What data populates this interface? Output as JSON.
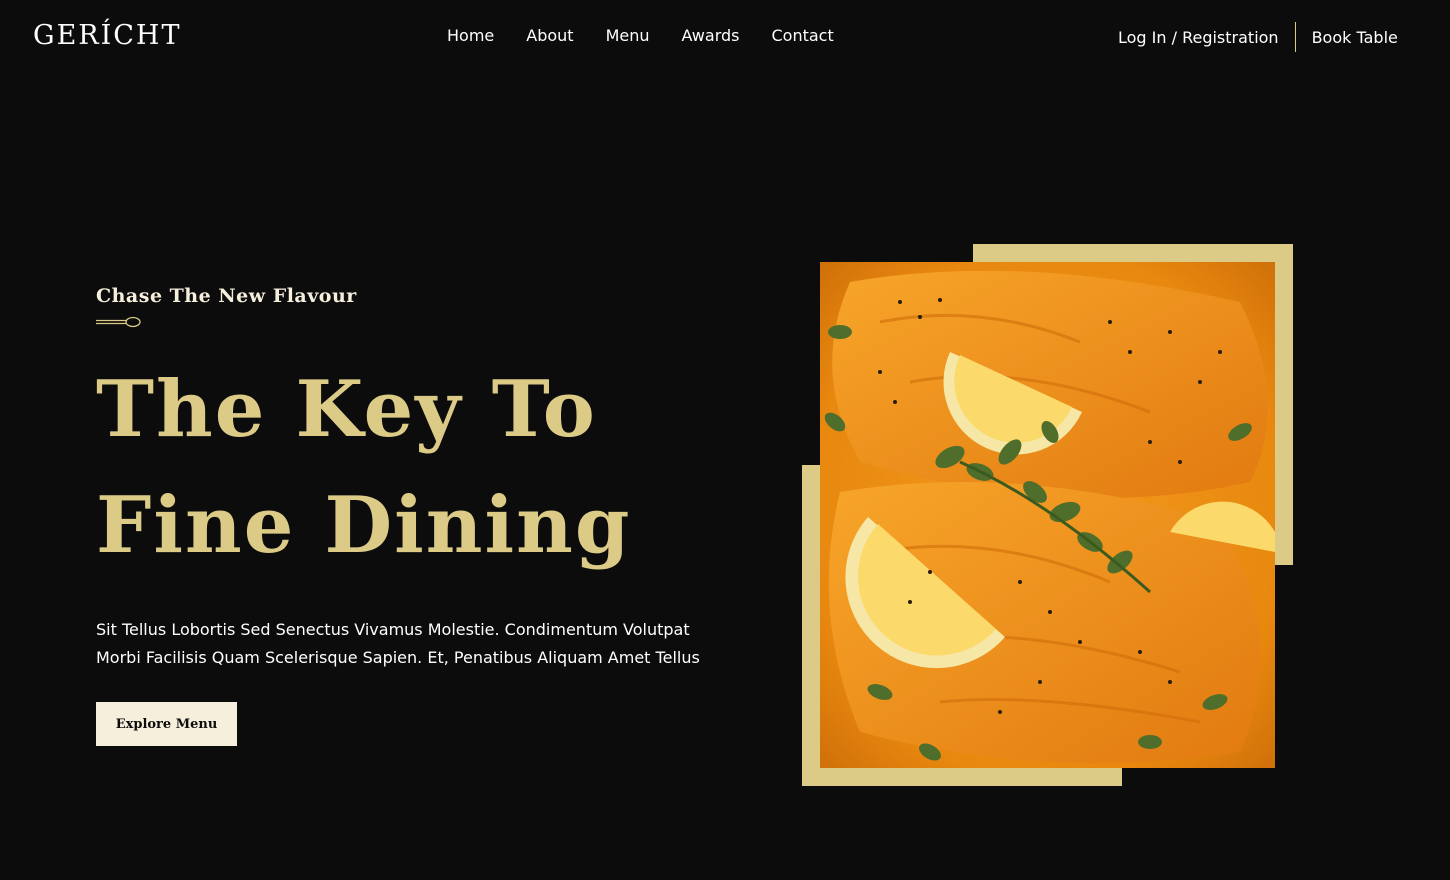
{
  "nav": {
    "logo": "GERÍCHT",
    "links": [
      "Home",
      "About",
      "Menu",
      "Awards",
      "Contact"
    ],
    "login": "Log In / Registration",
    "book": "Book Table"
  },
  "hero": {
    "subtitle": "Chase The New Flavour",
    "title_line1": "The Key To",
    "title_line2": "Fine Dining",
    "description": "Sit Tellus Lobortis Sed Senectus Vivamus Molestie. Condimentum Volutpat Morbi Facilisis Quam Scelerisque Sapien. Et, Penatibus Aliquam Amet Tellus",
    "button": "Explore Menu",
    "image_icon": "salmon-dish-photo",
    "spoon_icon": "spoon-icon"
  },
  "colors": {
    "background": "#0c0c0c",
    "golden": "#dcca87",
    "cream": "#f5efdb",
    "white": "#ffffff"
  }
}
